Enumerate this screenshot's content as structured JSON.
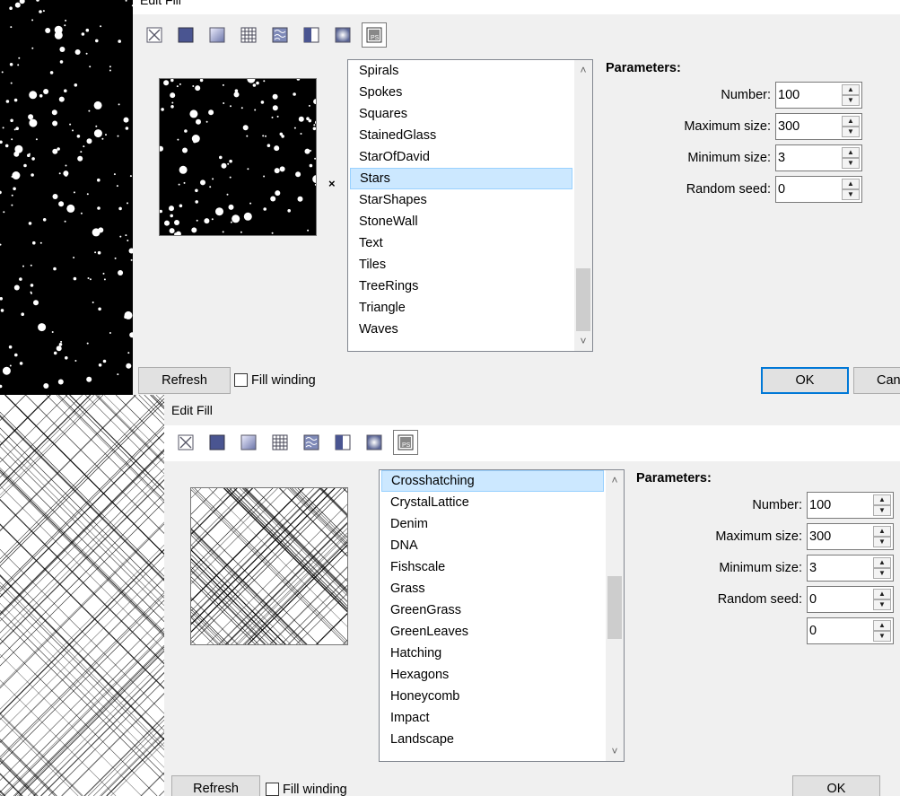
{
  "dialog1": {
    "title": "Edit Fill",
    "toolbar": [
      "no-fill-icon",
      "solid-fill-icon",
      "gradient-fill-icon",
      "pattern-fill-icon",
      "texture-fill-icon",
      "half-fill-icon",
      "image-fill-icon",
      "procedural-fill-icon"
    ],
    "list_items": [
      "Spirals",
      "Spokes",
      "Squares",
      "StainedGlass",
      "StarOfDavid",
      "Stars",
      "StarShapes",
      "StoneWall",
      "Text",
      "Tiles",
      "TreeRings",
      "Triangle",
      "Waves"
    ],
    "selected_index": 5,
    "x_mark": "×",
    "parameters_label": "Parameters:",
    "params": [
      {
        "label": "Number:",
        "value": "100"
      },
      {
        "label": "Maximum size:",
        "value": "300"
      },
      {
        "label": "Minimum size:",
        "value": "3"
      },
      {
        "label": "Random seed:",
        "value": "0"
      }
    ],
    "refresh_label": "Refresh",
    "fill_winding_label": "Fill winding",
    "ok_label": "OK",
    "cancel_label": "Can"
  },
  "dialog2": {
    "title": "Edit Fill",
    "toolbar": [
      "no-fill-icon",
      "solid-fill-icon",
      "gradient-fill-icon",
      "pattern-fill-icon",
      "texture-fill-icon",
      "half-fill-icon",
      "image-fill-icon",
      "procedural-fill-icon"
    ],
    "list_items": [
      "Crosshatching",
      "CrystalLattice",
      "Denim",
      "DNA",
      "Fishscale",
      "Grass",
      "GreenGrass",
      "GreenLeaves",
      "Hatching",
      "Hexagons",
      "Honeycomb",
      "Impact",
      "Landscape"
    ],
    "selected_index": 0,
    "parameters_label": "Parameters:",
    "params": [
      {
        "label": "Number:",
        "value": "100"
      },
      {
        "label": "Maximum size:",
        "value": "300"
      },
      {
        "label": "Minimum size:",
        "value": "3"
      },
      {
        "label": "Random seed:",
        "value": "0"
      },
      {
        "label": "",
        "value": "0"
      }
    ],
    "refresh_label": "Refresh",
    "fill_winding_label": "Fill winding",
    "ok_label": "OK"
  },
  "colors": {
    "selection": "#cce8ff",
    "accent": "#0078d7"
  }
}
